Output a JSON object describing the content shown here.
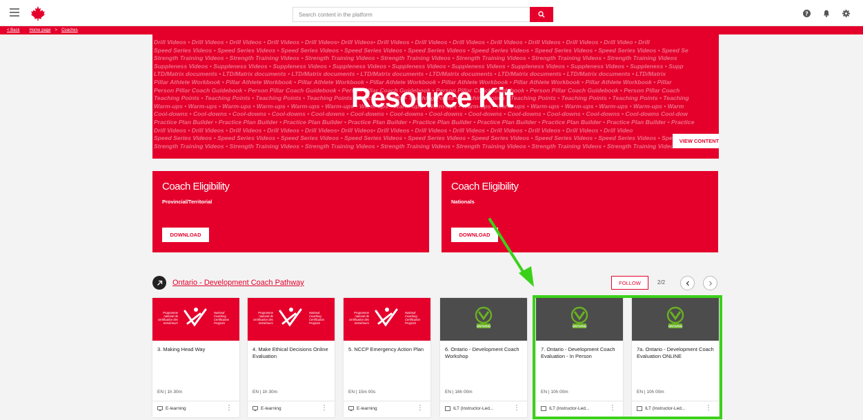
{
  "header": {
    "search_placeholder": "Search content in the platform"
  },
  "breadcrumb": {
    "back": "< Back",
    "home": "Home page",
    "separator": ">",
    "current": "Coaches"
  },
  "hero": {
    "title": "Resource Kit",
    "button": "VIEW CONTENT",
    "lines": [
      "Drill Videos • Drill Videos • Drill Videos • Drill Videos • Drill Videos• Drill Videos• Drill Videos • Drill Videos • Drill Videos • Drill Videos • Drill Videos • Drill Videos • Drill Video • Drill",
      "Speed Series Videos • Speed Series Videos • Speed Series Videos • Speed Series Videos • Speed Series Videos • Speed Series Videos • Speed Series Videos • Speed Series Videos • Speed Se",
      "Strength Training Videos • Strength Training Videos • Strength Training Videos • Strength Training Videos • Strength Training Videos • Strength Training Videos • Strength Training Videos",
      "Suppleness Videos • Suppleness Videos • Suppleness Videos • Suppleness Videos • Suppleness Videos • Suppleness Videos • Suppleness Videos • Suppleness Videos • Suppleness • Supp",
      "LTD/Matrix documents • LTD/Matrix documents • LTD/Matrix documents • LTD/Matrix documents • LTD/Matrix documents • LTD/Matrix documents • LTD/Matrix documents • LTD/Matrix",
      "Pillar Athlete Workbook • Pillar Athlete Workbook • Pillar Athlete Workbook • Pillar Athlete Workbook • Pillar Athlete Workbook • Pillar Athlete Workbook • Pillar Athlete Workbook • Pillar",
      "Person Pillar Coach Guidebook • Person Pillar Coach Guidebook • Person Pillar Coach Guidebook • Person Pillar Coach Guidebook • Person Pillar Coach Guidebook • Person Pillar Coach",
      "Teaching Points • Teaching Points • Teaching Points • Teaching Points • Teaching Points • Teaching Points • Teaching Points • Teaching Points • Teaching Points • Teaching Points • Teaching",
      "Warm-ups • Warm-ups • Warm-ups • Warm-ups • Warm-ups • Warm-ups • Warm-ups • Warm-ups • Warm-ups • Warm-ups • Warm-ups • Warm-ups • Warm-ups • Warm-ups • Warm-ups • Warm",
      "Cool-downs • Cool-downs • Cool-downs • Cool-downs • Cool-downs • Cool-downs • Cool-downs • Cool-downs • Cool-downs • Cool-downs • Cool-downs • Cool-downs • Cool-downs  Cool-dow",
      "Practice Plan Builder • Practice Plan Builder • Practice Plan Builder • Practice Plan Builder • Practice Plan Builder • Practice Plan Builder • Practice Plan Builder • Practice Plan Builder • Practice",
      "Drill Videos • Drill Videos • Drill Videos • Drill Videos • Drill Videos• Drill Videos• Drill Videos • Drill Videos • Drill Videos • Drill Videos • Drill Videos • Drill Videos • Drill Video",
      "Speed Series Videos • Speed Series Videos • Speed Series Videos • Speed Series Videos • Speed Series Videos • Speed Series Videos • Speed Series Videos • Speed Series Videos • Speed Series",
      "Strength Training Videos • Strength Training Videos • Strength Training Videos • Strength Training Videos • Strength Training Videos • Strength Training Videos • Strength Training Videos"
    ]
  },
  "eligibility": [
    {
      "title": "Coach Eligibility",
      "subtitle": "Provincial/Territorial",
      "button": "DOWNLOAD"
    },
    {
      "title": "Coach Eligibility",
      "subtitle": "Nationals",
      "button": "DOWNLOAD"
    }
  ],
  "pathway": {
    "title": "Ontario - Development Coach Pathway",
    "follow": "FOLLOW",
    "page": "2/2"
  },
  "logo_text": {
    "ncc_fr": "Programme national de certification des entraîneurs",
    "ncc_en": "National Coaching Certification Program",
    "ontario": "ONTARIO"
  },
  "cards": [
    {
      "thumb": "ncc",
      "title": "3. Making Head Way",
      "meta": "EN  |  1h 30m",
      "type": "E-learning"
    },
    {
      "thumb": "ncc",
      "title": "4. Make Ethical Decisions Online Evaluation",
      "meta": "EN  |  1h 30m",
      "type": "E-learning"
    },
    {
      "thumb": "ncc",
      "title": "5. NCCP Emergency Action Plan",
      "meta": "EN  |  15m 00s",
      "type": "E-learning"
    },
    {
      "thumb": "ontario",
      "title": "6. Ontario - Development Coach Workshop",
      "meta": "EN  |  16h 00m",
      "type": "ILT (Instructor-Led..."
    },
    {
      "thumb": "ontario",
      "title": "7. Ontario - Development Coach Evaluation - In Person",
      "meta": "EN  |  10h 00m",
      "type": "ILT (Instructor-Led..."
    },
    {
      "thumb": "ontario",
      "title": "7a. Ontario - Development Coach Evaluation ONLINE",
      "meta": "EN  |  10h 00m",
      "type": "ILT (Instructor-Led..."
    }
  ],
  "colors": {
    "brand_red": "#e4002b",
    "dark_thumb": "#4c4c4c",
    "highlight_green": "#3bd11a"
  },
  "icons": {
    "menu": "hamburger-icon",
    "logo": "maple-leaf-icon",
    "search": "search-icon",
    "help": "help-icon",
    "notifications": "bell-icon",
    "settings": "gear-icon",
    "pathway": "arrow-up-right-icon",
    "elearning": "monitor-icon",
    "ilt": "classroom-icon",
    "more": "more-vertical-icon"
  }
}
